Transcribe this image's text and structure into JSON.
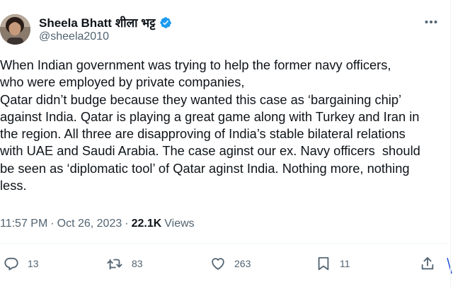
{
  "author": {
    "display_name": "Sheela Bhatt शीला भट्ट",
    "handle": "@sheela2010",
    "verified": true
  },
  "tweet": {
    "text": "When Indian government was trying to help the former navy officers,\nwho were employed by private companies,\nQatar didn’t budge because they wanted this case as ‘bargaining chip’\nagainst India. Qatar is playing a great game along with Turkey and Iran in\nthe region. All three are disapproving of India’s stable bilateral relations\nwith UAE and Saudi Arabia. The case aginst our ex. Navy officers  should\nbe seen as ‘diplomatic tool’ of Qatar aginst India. Nothing more, nothing\nless."
  },
  "meta": {
    "time": "11:57 PM",
    "separator": "·",
    "date": "Oct 26, 2023",
    "views_count": "22.1K",
    "views_label": "Views"
  },
  "actions": {
    "replies": "13",
    "retweets": "83",
    "likes": "263",
    "bookmarks": "11"
  },
  "colors": {
    "text": "#0f1419",
    "secondary": "#536471",
    "verified": "#1d9bf0",
    "divider": "#eff3f4"
  }
}
